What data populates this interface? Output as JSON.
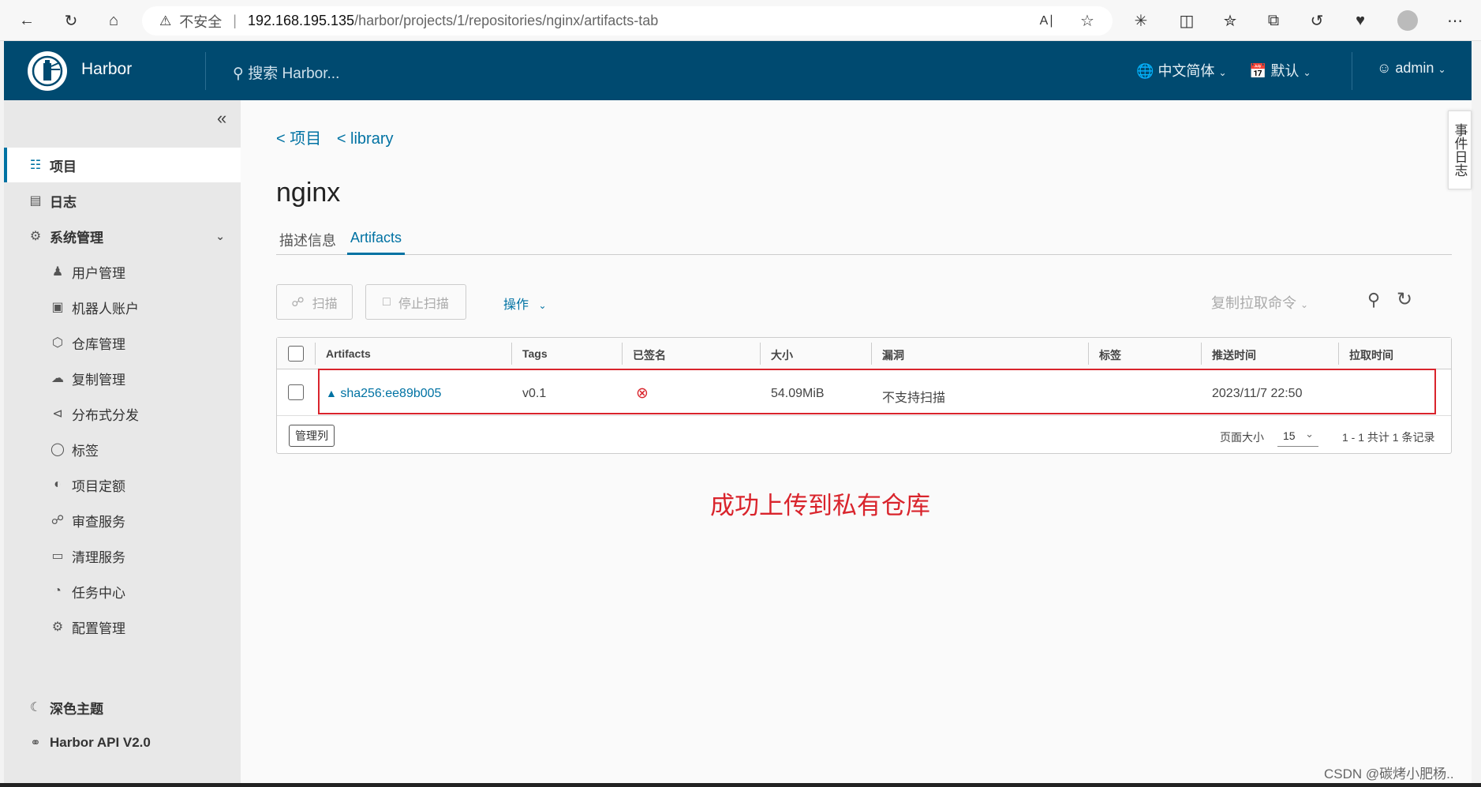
{
  "browser": {
    "warn_icon": "warning-triangle-icon",
    "insecure": "不安全",
    "url_host": "192.168.195.135",
    "url_path": "/harbor/projects/1/repositories/nginx/artifacts-tab"
  },
  "header": {
    "brand": "Harbor",
    "search_placeholder": "搜索 Harbor...",
    "language": "中文简体",
    "date_format": "默认",
    "user": "admin"
  },
  "sidebar": {
    "items": [
      {
        "label": "项目"
      },
      {
        "label": "日志"
      },
      {
        "label": "系统管理"
      },
      {
        "label": "用户管理"
      },
      {
        "label": "机器人账户"
      },
      {
        "label": "仓库管理"
      },
      {
        "label": "复制管理"
      },
      {
        "label": "分布式分发"
      },
      {
        "label": "标签"
      },
      {
        "label": "项目定额"
      },
      {
        "label": "审查服务"
      },
      {
        "label": "清理服务"
      },
      {
        "label": "任务中心"
      },
      {
        "label": "配置管理"
      }
    ],
    "dark_theme": "深色主题",
    "api": "Harbor API V2.0"
  },
  "main": {
    "crumbs": [
      "< 项目",
      "< library"
    ],
    "title": "nginx",
    "tabs": [
      "描述信息",
      "Artifacts"
    ],
    "toolbar": {
      "scan": "扫描",
      "stop_scan": "停止扫描",
      "actions": "操作",
      "copy_pull": "复制拉取命令"
    },
    "table": {
      "headers": [
        "Artifacts",
        "Tags",
        "已签名",
        "大小",
        "漏洞",
        "标签",
        "推送时间",
        "拉取时间"
      ],
      "rows": [
        {
          "artifact": "sha256:ee89b005",
          "tags": "v0.1",
          "signed": "⊗",
          "size": "54.09MiB",
          "vuln": "不支持扫描",
          "labels": "",
          "push_time": "2023/11/7 22:50",
          "pull_time": ""
        }
      ],
      "manage_columns": "管理列",
      "page_size_label": "页面大小",
      "page_size": "15",
      "pagination": "1 - 1 共计 1 条记录"
    },
    "annotation": "成功上传到私有仓库"
  },
  "right_panel": "事件日志",
  "watermark": "CSDN @碳烤小肥杨..",
  "colors": {
    "header_bg": "#004a70",
    "accent": "#0072a3",
    "highlight": "#d9242c"
  }
}
